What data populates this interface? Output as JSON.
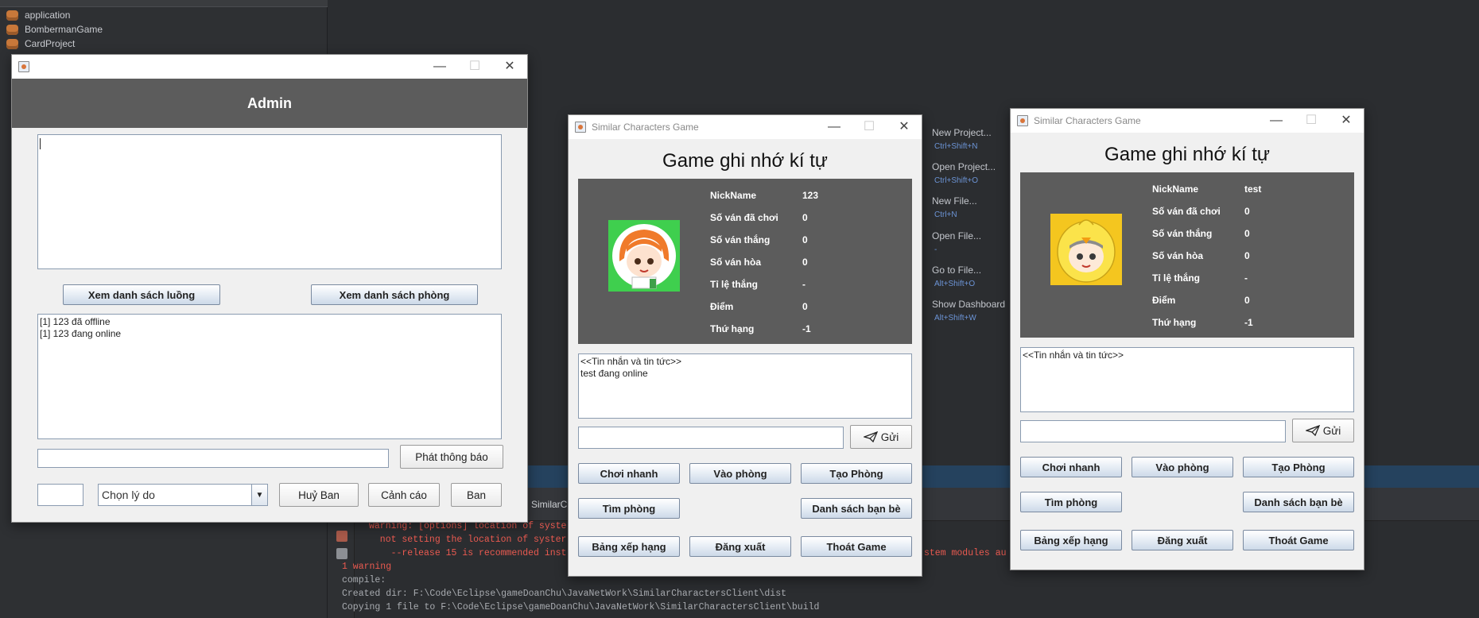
{
  "ide": {
    "project_tree": [
      "application",
      "BombermanGame",
      "CardProject"
    ],
    "welcome_links": [
      {
        "label": "New Project...",
        "shortcut": "Ctrl+Shift+N"
      },
      {
        "label": "Open Project...",
        "shortcut": "Ctrl+Shift+O"
      },
      {
        "label": "New File...",
        "shortcut": "Ctrl+N"
      },
      {
        "label": "Open File...",
        "shortcut": "-"
      },
      {
        "label": "Go to File...",
        "shortcut": "Alt+Shift+O"
      },
      {
        "label": "Show Dashboard",
        "shortcut": "Alt+Shift+W"
      }
    ],
    "output_tab": "SimilarCh",
    "console_lines": [
      {
        "text": "warning: [options] location of syste",
        "color": "red"
      },
      {
        "text": "  not setting the location of syster",
        "color": "red"
      },
      {
        "text": "    --release 15 is recommended inst",
        "color": "red"
      },
      {
        "text": "1 warning",
        "color": "red"
      },
      {
        "text": "compile:",
        "color": "gray"
      },
      {
        "text": "Created dir: F:\\Code\\Eclipse\\gameDoanChu\\JavaNetWork\\SimilarCharactersClient\\dist",
        "color": "gray"
      },
      {
        "text": "Copying 1 file to F:\\Code\\Eclipse\\gameDoanChu\\JavaNetWork\\SimilarCharactersClient\\build",
        "color": "gray"
      }
    ],
    "console_tail": "stem modules au"
  },
  "admin": {
    "header": "Admin",
    "buttons": {
      "threads": "Xem danh sách luồng",
      "rooms": "Xem danh sách phòng",
      "broadcast": "Phát thông báo",
      "unban": "Huỷ Ban",
      "warn": "Cảnh cáo",
      "ban": "Ban"
    },
    "log_lines": [
      "[1] 123 đã offline",
      "[1] 123 đang online"
    ],
    "reason_select": "Chọn lý do"
  },
  "client1": {
    "window_title": "Similar Characters Game",
    "game_title": "Game ghi nhớ kí tự",
    "labels": [
      "NickName",
      "Số ván đã chơi",
      "Số ván thắng",
      "Số ván hòa",
      "Tỉ lệ thắng",
      "Điểm",
      "Thứ hạng"
    ],
    "values": [
      "123",
      "0",
      "0",
      "0",
      "-",
      "0",
      "-1"
    ],
    "chat_lines": [
      "<<Tin nhắn và tin tức>>",
      "test đang online"
    ],
    "send": "Gửi",
    "buttons": [
      "Chơi nhanh",
      "Vào phòng",
      "Tạo Phòng",
      "Tìm phòng",
      "Danh sách bạn bè",
      "Bảng xếp hạng",
      "Đăng xuất",
      "Thoát Game"
    ]
  },
  "client2": {
    "window_title": "Similar Characters Game",
    "game_title": "Game ghi nhớ kí tự",
    "labels": [
      "NickName",
      "Số ván đã chơi",
      "Số ván thắng",
      "Số ván hòa",
      "Tỉ lệ thắng",
      "Điểm",
      "Thứ hạng"
    ],
    "values": [
      "test",
      "0",
      "0",
      "0",
      "-",
      "0",
      "-1"
    ],
    "chat_lines": [
      "<<Tin nhắn và tin tức>>"
    ],
    "send": "Gửi",
    "buttons": [
      "Chơi nhanh",
      "Vào phòng",
      "Tạo Phòng",
      "Tìm phòng",
      "Danh sách bạn bè",
      "Bảng xếp hạng",
      "Đăng xuất",
      "Thoát Game"
    ]
  },
  "colors": {
    "ide_bg": "#2b2d30",
    "panel_gray": "#5c5c5c",
    "avatar1_bg": "#3fcf4e",
    "avatar2_bg": "#f4c61f",
    "console_red": "#ea5a50"
  },
  "icons": [
    "java-icon",
    "minimize-icon",
    "maximize-icon",
    "close-icon",
    "send-paper-plane-icon",
    "dropdown-arrow-icon",
    "coffee-cup-project-icon"
  ]
}
